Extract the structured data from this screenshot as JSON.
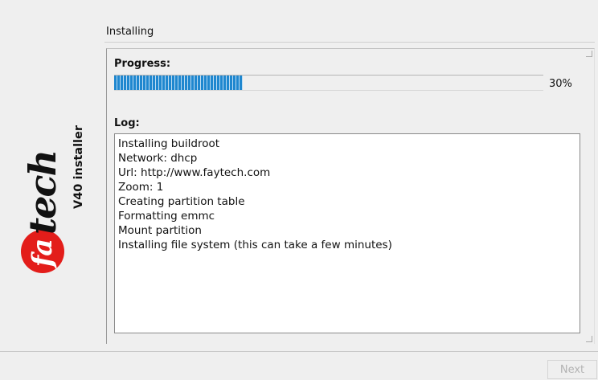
{
  "brand": {
    "logo_fa": "fa",
    "logo_tech": "tech",
    "subtitle": "V40 installer",
    "logo_color": "#e31d1a"
  },
  "page": {
    "title": "Installing"
  },
  "progress": {
    "label": "Progress:",
    "percent": 30,
    "percent_text": "30%",
    "bar_color": "#1f87cf"
  },
  "log": {
    "label": "Log:",
    "lines": [
      "Installing buildroot",
      "Network: dhcp",
      "Url:  http://www.faytech.com",
      "Zoom:  1",
      "Creating partition table",
      "Formatting emmc",
      "Mount partition",
      "Installing file system (this can take a few minutes)"
    ]
  },
  "footer": {
    "next_label": "Next",
    "next_enabled": false
  }
}
